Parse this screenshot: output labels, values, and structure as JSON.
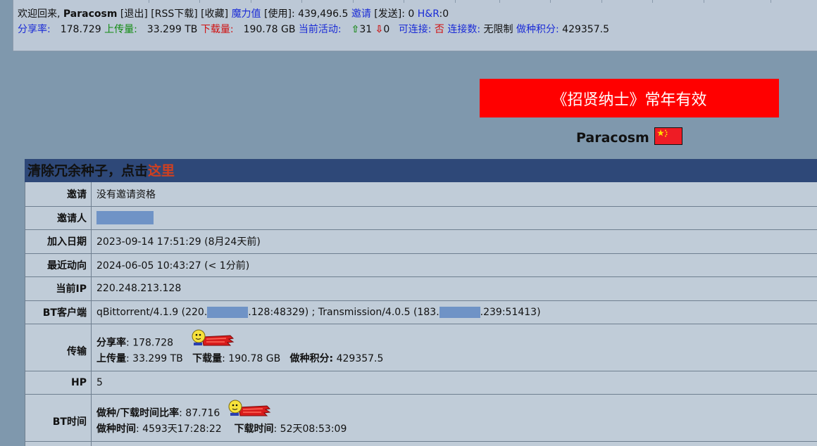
{
  "topbar": {
    "welcome": "欢迎回来, ",
    "username": "Paracosm",
    "logout": "[退出]",
    "rss": "[RSS下载]",
    "favorites": "[收藏]",
    "bonus_label": "魔力值",
    "use_link": "[使用]",
    "bonus_value": ": 439,496.5",
    "invite_label": "邀请",
    "send_link": "[发送]",
    "invite_value": ": 0",
    "hnr_label": "H&R",
    "hnr_value": ":0",
    "ratio_label": "分享率:",
    "ratio_value": "178.729",
    "upload_label": "上传量:",
    "upload_value": "33.299 TB",
    "download_label": "下载量:",
    "download_value": "190.78 GB",
    "active_label": "当前活动:",
    "seeding_count": "31",
    "leeching_count": "0",
    "connectable_label": "可连接:",
    "connectable_value": "否",
    "connections_label": "连接数:",
    "connections_value": "无限制",
    "seed_points_label": "做种积分:",
    "seed_points_value": "429357.5"
  },
  "banner": {
    "text": "《招贤纳士》常年有效",
    "bg": "#ff0000"
  },
  "profile": {
    "username": "Paracosm",
    "flag_icon": "china-flag-icon"
  },
  "panel": {
    "header_text": "清除冗余种子，点击",
    "header_link": "这里",
    "rows": {
      "invite": {
        "label": "邀请",
        "value": "没有邀请资格"
      },
      "inviter": {
        "label": "邀请人"
      },
      "join_date": {
        "label": "加入日期",
        "value": "2023-09-14 17:51:29 (8月24天前)"
      },
      "last_action": {
        "label": "最近动向",
        "value": "2024-06-05 10:43:27 (< 1分前)"
      },
      "current_ip": {
        "label": "当前IP",
        "value": "220.248.213.128"
      },
      "bt_client": {
        "label": "BT客户端",
        "part1": "qBittorrent/4.1.9 (220.",
        "part2": ".128:48329) ; Transmission/4.0.5 (183.",
        "part3": ".239:51413)"
      },
      "transfer": {
        "label": "传输",
        "ratio_label": "分享率",
        "ratio_value": ": 178.728",
        "upload_label": "上传量",
        "upload_value": ": 33.299 TB",
        "download_label": "下载量",
        "download_value": ": 190.78 GB",
        "points_label": "做种积分:",
        "points_value": " 429357.5"
      },
      "hp": {
        "label": "HP",
        "value": "5"
      },
      "bt_time": {
        "label": "BT时间",
        "ratio_label": "做种/下载时间比率",
        "ratio_value": ": 87.716",
        "seed_time_label": "做种时间",
        "seed_time_value": ": 4593天17:28:22",
        "dl_time_label": "下载时间",
        "dl_time_value": ": 52天08:53:09"
      }
    }
  },
  "colors": {
    "page_bg": "#7f98ad",
    "topbar_bg": "#bcc8d6",
    "panel_bg": "#c0ccd8",
    "panel_header_bg": "#2e4878",
    "link_blue": "#1a2bd6",
    "redaction": "#6f93c6"
  }
}
